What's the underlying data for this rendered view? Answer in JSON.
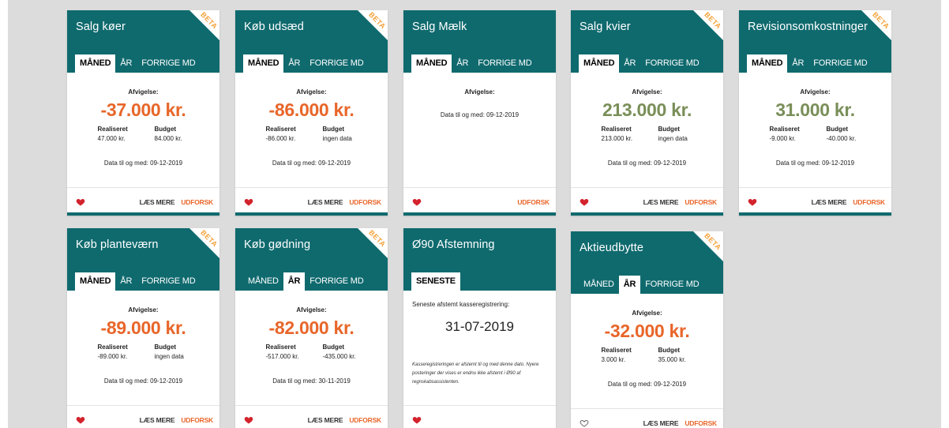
{
  "colors": {
    "teal": "#0f6a6e",
    "orange": "#e8662a",
    "green": "#7a8f59",
    "beta": "#f4a23a"
  },
  "labels": {
    "afvigelse": "Afvigelse:",
    "realiseret": "Realiseret",
    "budget": "Budget",
    "laes_mere": "LÆS MERE",
    "udforsk": "UDFORSK",
    "beta": "BETA"
  },
  "cards": [
    {
      "title": "Salg køer",
      "beta": true,
      "tabs": [
        "MÅNED",
        "ÅR",
        "FORRIGE MD"
      ],
      "active_tab": 0,
      "amount": "-37.000 kr.",
      "realiseret": "47.000 kr.",
      "budget": "84.000 kr.",
      "date_text": "Data til og med: 09-12-2019",
      "favorite": true
    },
    {
      "title": "Køb udsæd",
      "beta": true,
      "tabs": [
        "MÅNED",
        "ÅR",
        "FORRIGE MD"
      ],
      "active_tab": 0,
      "amount": "-86.000 kr.",
      "realiseret": "-86.000 kr.",
      "budget": "ingen data",
      "date_text": "Data til og med: 09-12-2019",
      "favorite": true
    },
    {
      "title": "Salg Mælk",
      "beta": false,
      "tabs": [
        "MÅNED",
        "ÅR",
        "FORRIGE MD"
      ],
      "active_tab": 0,
      "date_text": "Data til og med: 09-12-2019",
      "favorite": true
    },
    {
      "title": "Salg kvier",
      "beta": true,
      "tabs": [
        "MÅNED",
        "ÅR",
        "FORRIGE MD"
      ],
      "active_tab": 0,
      "amount": "213.000 kr.",
      "realiseret": "213.000 kr.",
      "budget": "ingen data",
      "date_text": "Data til og med: 09-12-2019",
      "favorite": true
    },
    {
      "title": "Revisionsomkostninger",
      "beta": true,
      "tabs": [
        "MÅNED",
        "ÅR",
        "FORRIGE MD"
      ],
      "active_tab": 0,
      "amount": "31.000 kr.",
      "realiseret": "-9.000 kr.",
      "budget": "-40.000 kr.",
      "date_text": "Data til og med: 09-12-2019",
      "favorite": true
    },
    {
      "title": "Køb planteværn",
      "beta": true,
      "tabs": [
        "MÅNED",
        "ÅR",
        "FORRIGE MD"
      ],
      "active_tab": 0,
      "amount": "-89.000 kr.",
      "realiseret": "-89.000 kr.",
      "budget": "ingen data",
      "date_text": "Data til og med: 09-12-2019",
      "favorite": true
    },
    {
      "title": "Køb gødning",
      "beta": true,
      "tabs": [
        "MÅNED",
        "ÅR",
        "FORRIGE MD"
      ],
      "active_tab": 1,
      "amount": "-82.000 kr.",
      "realiseret": "-517.000 kr.",
      "budget": "-435.000 kr.",
      "date_text": "Data til og med: 30-11-2019",
      "favorite": true
    },
    {
      "title": "Ø90 Afstemning",
      "beta": false,
      "tabs": [
        "SENESTE"
      ],
      "active_tab": 0,
      "seneste_label": "Seneste afstemt kasseregistrering:",
      "seneste_date": "31-07-2019",
      "note": "Kasseregistreringen er afstemt til og med denne dato. Nyere posteringer der vises er endnu ikke afstemt i Ø90 af regnskabsassistenten.",
      "favorite": true
    },
    {
      "title": "Aktieudbytte",
      "beta": true,
      "tabs": [
        "MÅNED",
        "ÅR",
        "FORRIGE MD"
      ],
      "active_tab": 1,
      "amount": "-32.000 kr.",
      "realiseret": "3.000 kr.",
      "budget": "35.000 kr.",
      "date_text": "Data til og med: 09-12-2019",
      "favorite": false
    }
  ]
}
